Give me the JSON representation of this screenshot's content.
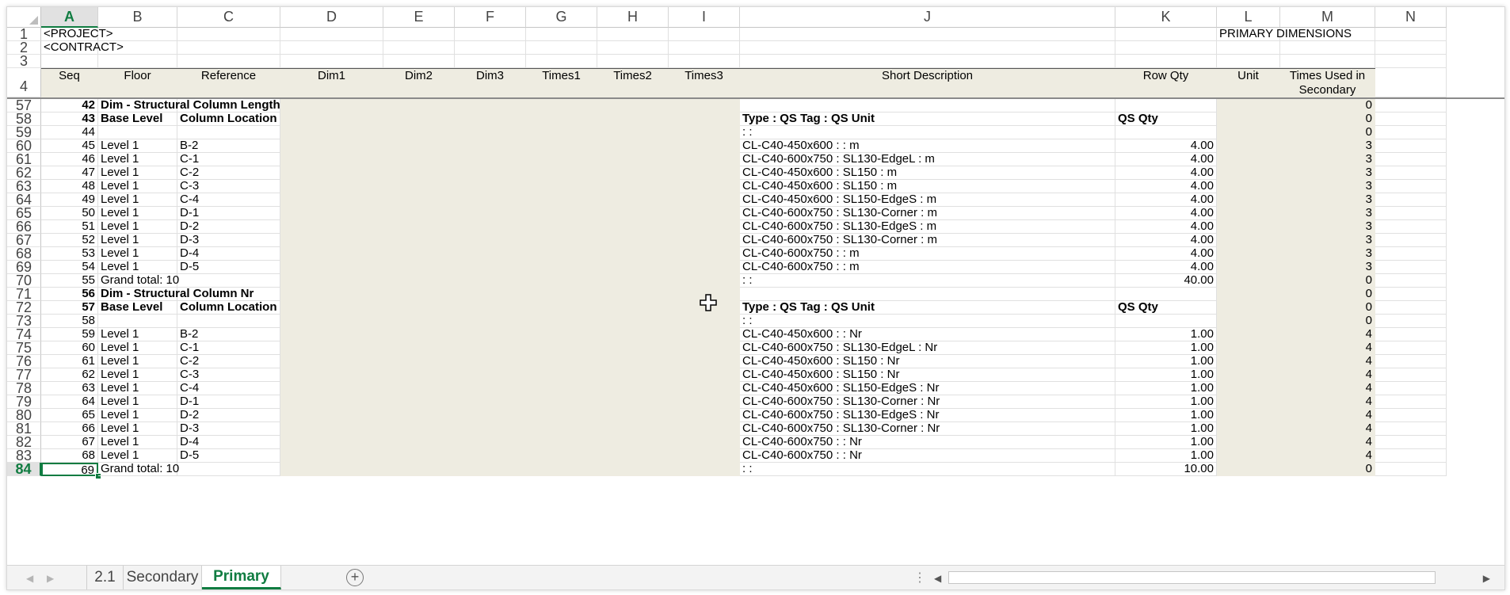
{
  "columns": [
    "A",
    "B",
    "C",
    "D",
    "E",
    "F",
    "G",
    "H",
    "I",
    "J",
    "K",
    "L",
    "M",
    "N"
  ],
  "selected_column": "A",
  "selected_row": "84",
  "title_rows": [
    {
      "row": "1",
      "a": "<PROJECT>",
      "l": "PRIMARY DIMENSIONS"
    },
    {
      "row": "2",
      "a": "<CONTRACT>",
      "l": ""
    },
    {
      "row": "3",
      "a": "",
      "l": ""
    }
  ],
  "header_row": {
    "row": "4",
    "labels": [
      "Seq",
      "Floor",
      "Reference",
      "Dim1",
      "Dim2",
      "Dim3",
      "Times1",
      "Times2",
      "Times3",
      "Short Description",
      "Row Qty",
      "Unit",
      "Times Used in Secondary"
    ]
  },
  "rows": [
    {
      "r": "57",
      "seq": "42",
      "b": "Dim - Structural Column Length",
      "c": "",
      "j": "",
      "k": "",
      "m": "0",
      "bold": true
    },
    {
      "r": "58",
      "seq": "43",
      "b": "Base Level",
      "c": "Column Location Mark",
      "j": "Type : QS Tag : QS Unit",
      "k": "QS Qty",
      "m": "0",
      "bold": true
    },
    {
      "r": "59",
      "seq": "44",
      "b": "",
      "c": "",
      "j": " :  : ",
      "k": "",
      "m": "0"
    },
    {
      "r": "60",
      "seq": "45",
      "b": "Level 1",
      "c": "B-2",
      "j": "CL-C40-450x600 :  : m",
      "k": "4.00",
      "m": "3"
    },
    {
      "r": "61",
      "seq": "46",
      "b": "Level 1",
      "c": "C-1",
      "j": "CL-C40-600x750 : SL130-EdgeL : m",
      "k": "4.00",
      "m": "3"
    },
    {
      "r": "62",
      "seq": "47",
      "b": "Level 1",
      "c": "C-2",
      "j": "CL-C40-450x600 : SL150 : m",
      "k": "4.00",
      "m": "3"
    },
    {
      "r": "63",
      "seq": "48",
      "b": "Level 1",
      "c": "C-3",
      "j": "CL-C40-450x600 : SL150 : m",
      "k": "4.00",
      "m": "3"
    },
    {
      "r": "64",
      "seq": "49",
      "b": "Level 1",
      "c": "C-4",
      "j": "CL-C40-450x600 : SL150-EdgeS : m",
      "k": "4.00",
      "m": "3"
    },
    {
      "r": "65",
      "seq": "50",
      "b": "Level 1",
      "c": "D-1",
      "j": "CL-C40-600x750 : SL130-Corner : m",
      "k": "4.00",
      "m": "3"
    },
    {
      "r": "66",
      "seq": "51",
      "b": "Level 1",
      "c": "D-2",
      "j": "CL-C40-600x750 : SL130-EdgeS : m",
      "k": "4.00",
      "m": "3"
    },
    {
      "r": "67",
      "seq": "52",
      "b": "Level 1",
      "c": "D-3",
      "j": "CL-C40-600x750 : SL130-Corner : m",
      "k": "4.00",
      "m": "3"
    },
    {
      "r": "68",
      "seq": "53",
      "b": "Level 1",
      "c": "D-4",
      "j": "CL-C40-600x750 :  : m",
      "k": "4.00",
      "m": "3"
    },
    {
      "r": "69",
      "seq": "54",
      "b": "Level 1",
      "c": "D-5",
      "j": "CL-C40-600x750 :  : m",
      "k": "4.00",
      "m": "3"
    },
    {
      "r": "70",
      "seq": "55",
      "b": "Grand total: 10",
      "c": "",
      "j": " :  : ",
      "k": "40.00",
      "m": "0"
    },
    {
      "r": "71",
      "seq": "56",
      "b": "Dim - Structural Column Nr",
      "c": "",
      "j": "",
      "k": "",
      "m": "0",
      "bold": true
    },
    {
      "r": "72",
      "seq": "57",
      "b": "Base Level",
      "c": "Column Location Mark",
      "j": "Type : QS Tag : QS Unit",
      "k": "QS Qty",
      "m": "0",
      "bold": true
    },
    {
      "r": "73",
      "seq": "58",
      "b": "",
      "c": "",
      "j": " :  : ",
      "k": "",
      "m": "0"
    },
    {
      "r": "74",
      "seq": "59",
      "b": "Level 1",
      "c": "B-2",
      "j": "CL-C40-450x600 :  : Nr",
      "k": "1.00",
      "m": "4"
    },
    {
      "r": "75",
      "seq": "60",
      "b": "Level 1",
      "c": "C-1",
      "j": "CL-C40-600x750 : SL130-EdgeL : Nr",
      "k": "1.00",
      "m": "4"
    },
    {
      "r": "76",
      "seq": "61",
      "b": "Level 1",
      "c": "C-2",
      "j": "CL-C40-450x600 : SL150 : Nr",
      "k": "1.00",
      "m": "4"
    },
    {
      "r": "77",
      "seq": "62",
      "b": "Level 1",
      "c": "C-3",
      "j": "CL-C40-450x600 : SL150 : Nr",
      "k": "1.00",
      "m": "4"
    },
    {
      "r": "78",
      "seq": "63",
      "b": "Level 1",
      "c": "C-4",
      "j": "CL-C40-450x600 : SL150-EdgeS : Nr",
      "k": "1.00",
      "m": "4"
    },
    {
      "r": "79",
      "seq": "64",
      "b": "Level 1",
      "c": "D-1",
      "j": "CL-C40-600x750 : SL130-Corner : Nr",
      "k": "1.00",
      "m": "4"
    },
    {
      "r": "80",
      "seq": "65",
      "b": "Level 1",
      "c": "D-2",
      "j": "CL-C40-600x750 : SL130-EdgeS : Nr",
      "k": "1.00",
      "m": "4"
    },
    {
      "r": "81",
      "seq": "66",
      "b": "Level 1",
      "c": "D-3",
      "j": "CL-C40-600x750 : SL130-Corner : Nr",
      "k": "1.00",
      "m": "4"
    },
    {
      "r": "82",
      "seq": "67",
      "b": "Level 1",
      "c": "D-4",
      "j": "CL-C40-600x750 :  : Nr",
      "k": "1.00",
      "m": "4"
    },
    {
      "r": "83",
      "seq": "68",
      "b": "Level 1",
      "c": "D-5",
      "j": "CL-C40-600x750 :  : Nr",
      "k": "1.00",
      "m": "4"
    },
    {
      "r": "84",
      "seq": "69",
      "b": "Grand total: 10",
      "c": "",
      "j": " :  : ",
      "k": "10.00",
      "m": "0"
    }
  ],
  "tabs": [
    {
      "label": "2.1",
      "active": false
    },
    {
      "label": "Secondary",
      "active": false
    },
    {
      "label": "Primary",
      "active": true
    }
  ],
  "icons": {
    "nav_prev": "chevron-left-icon",
    "nav_next": "chevron-right-icon",
    "add_sheet": "plus-circle-icon",
    "cursor": "crosshair-cursor-icon",
    "options": "vertical-dots-icon"
  },
  "colors": {
    "accent": "#107c41",
    "header_fill": "#eeece1"
  }
}
